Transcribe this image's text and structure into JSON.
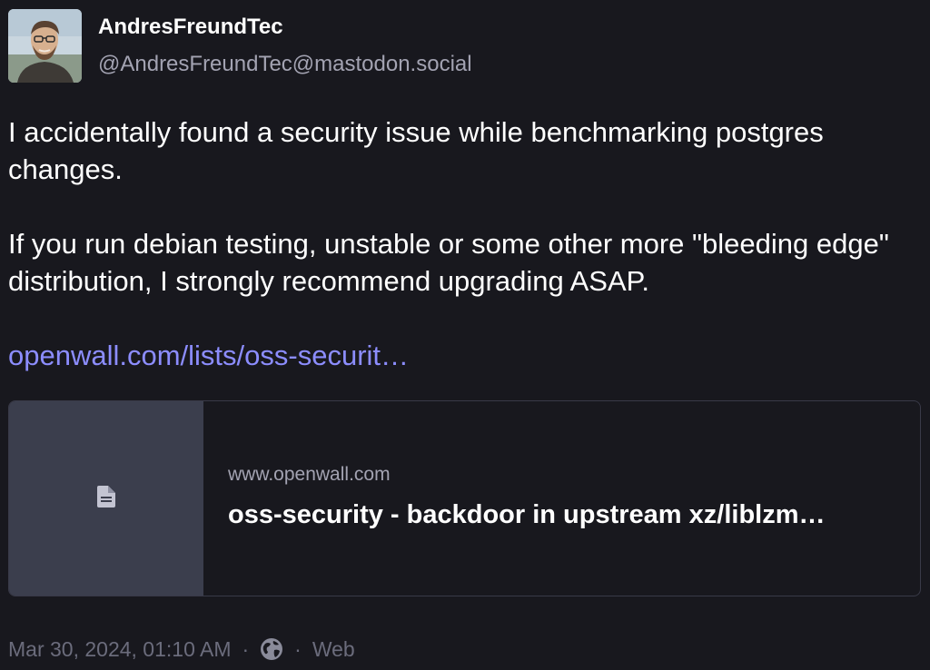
{
  "author": {
    "display_name": "AndresFreundTec",
    "handle": "@AndresFreundTec@mastodon.social",
    "avatar_icon": "avatar-photo"
  },
  "content": {
    "paragraph1": "I accidentally found a security issue while benchmarking postgres changes.",
    "paragraph2": "If you run debian testing, unstable or some other more \"bleeding edge\" distribution, I strongly recommend upgrading ASAP.",
    "link_text": "openwall.com/lists/oss-securit…"
  },
  "card": {
    "domain": "www.openwall.com",
    "title": "oss-security - backdoor in upstream xz/liblzm…",
    "icon": "file-icon"
  },
  "meta": {
    "timestamp": "Mar 30, 2024, 01:10 AM",
    "sep1": "·",
    "visibility_icon": "globe-icon",
    "sep2": "·",
    "application": "Web"
  },
  "colors": {
    "background": "#18181e",
    "link": "#8c8dff",
    "muted": "#a3a3b2",
    "card_thumb": "#3b3e4d"
  }
}
